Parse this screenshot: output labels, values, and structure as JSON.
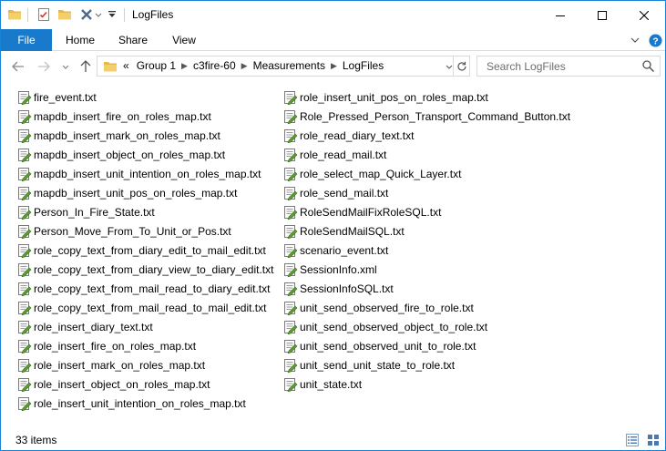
{
  "window": {
    "title": "LogFiles"
  },
  "ribbon": {
    "tabs": [
      "File",
      "Home",
      "Share",
      "View"
    ]
  },
  "address": {
    "overflow": "«",
    "crumbs": [
      "Group 1",
      "c3fire-60",
      "Measurements",
      "LogFiles"
    ]
  },
  "search": {
    "placeholder": "Search LogFiles"
  },
  "files": {
    "left": [
      "fire_event.txt",
      "mapdb_insert_fire_on_roles_map.txt",
      "mapdb_insert_mark_on_roles_map.txt",
      "mapdb_insert_object_on_roles_map.txt",
      "mapdb_insert_unit_intention_on_roles_map.txt",
      "mapdb_insert_unit_pos_on_roles_map.txt",
      "Person_In_Fire_State.txt",
      "Person_Move_From_To_Unit_or_Pos.txt",
      "role_copy_text_from_diary_edit_to_mail_edit.txt",
      "role_copy_text_from_diary_view_to_diary_edit.txt",
      "role_copy_text_from_mail_read_to_diary_edit.txt",
      "role_copy_text_from_mail_read_to_mail_edit.txt",
      "role_insert_diary_text.txt",
      "role_insert_fire_on_roles_map.txt",
      "role_insert_mark_on_roles_map.txt",
      "role_insert_object_on_roles_map.txt",
      "role_insert_unit_intention_on_roles_map.txt"
    ],
    "right": [
      "role_insert_unit_pos_on_roles_map.txt",
      "Role_Pressed_Person_Transport_Command_Button.txt",
      "role_read_diary_text.txt",
      "role_read_mail.txt",
      "role_select_map_Quick_Layer.txt",
      "role_send_mail.txt",
      "RoleSendMailFixRoleSQL.txt",
      "RoleSendMailSQL.txt",
      "scenario_event.txt",
      "SessionInfo.xml",
      "SessionInfoSQL.txt",
      "unit_send_observed_fire_to_role.txt",
      "unit_send_observed_object_to_role.txt",
      "unit_send_observed_unit_to_role.txt",
      "unit_send_unit_state_to_role.txt",
      "unit_state.txt"
    ]
  },
  "status": {
    "item_count": "33 items"
  },
  "colors": {
    "accent": "#1979ca",
    "border": "#1883d7",
    "folder": "#e8b84a",
    "file_icon_green": "#5a9e2f"
  },
  "icons": {
    "folder": "folder-icon",
    "properties": "properties-icon",
    "new_folder": "new-folder-icon",
    "delete": "delete-icon",
    "customize": "customize-qat-icon",
    "minimize": "minimize-icon",
    "maximize": "maximize-icon",
    "close": "close-icon",
    "expand_ribbon": "chevron-down-icon",
    "help": "help-icon",
    "back": "back-arrow-icon",
    "forward": "forward-arrow-icon",
    "recent": "recent-locations-icon",
    "up": "up-arrow-icon",
    "refresh": "refresh-icon",
    "search": "search-icon",
    "file": "text-file-icon",
    "details_view": "details-view-icon",
    "large_icons_view": "large-icons-view-icon"
  }
}
